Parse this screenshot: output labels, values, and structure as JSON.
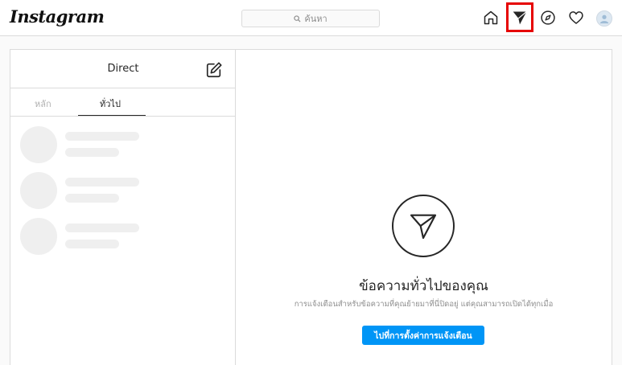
{
  "header": {
    "logo_text": "Instagram",
    "search_placeholder": "ค้นหา",
    "icons": [
      "home-icon",
      "direct-icon",
      "explore-icon",
      "activity-heart-icon",
      "profile-avatar"
    ]
  },
  "inbox": {
    "title": "Direct",
    "tabs": [
      {
        "label": "หลัก",
        "active": false
      },
      {
        "label": "ทั่วไป",
        "active": true
      }
    ]
  },
  "empty_state": {
    "title": "ข้อความทั่วไปของคุณ",
    "subtitle": "การแจ้งเตือนสำหรับข้อความที่คุณย้ายมาที่นี่ปิดอยู่ แต่คุณสามารถเปิดได้ทุกเมื่อ",
    "button_label": "ไปที่การตั้งค่าการแจ้งเตือน"
  },
  "colors": {
    "accent": "#0095f6",
    "highlight": "#e60000"
  }
}
